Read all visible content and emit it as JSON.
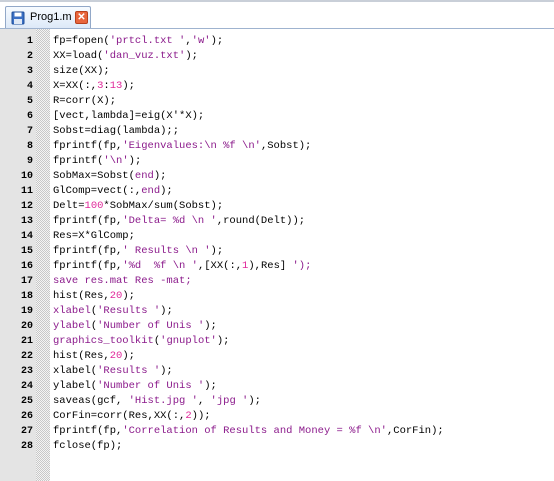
{
  "tab": {
    "label": "Prog1.m",
    "close_label": "✕",
    "icon": "floppy-disk-icon"
  },
  "colors": {
    "string": "#8b1a8b",
    "number": "#e0289a",
    "gutter": "#e4e4e4",
    "close": "#e8653c"
  },
  "editor": {
    "lines": [
      {
        "n": "1",
        "segs": [
          {
            "t": "fp=fopen("
          },
          {
            "t": "'prtcl.txt '",
            "c": "str"
          },
          {
            "t": ","
          },
          {
            "t": "'w'",
            "c": "str"
          },
          {
            "t": ");"
          }
        ]
      },
      {
        "n": "2",
        "segs": [
          {
            "t": "XX=load("
          },
          {
            "t": "'dan_vuz.txt'",
            "c": "str"
          },
          {
            "t": ");"
          }
        ]
      },
      {
        "n": "3",
        "segs": [
          {
            "t": "size(XX);"
          }
        ]
      },
      {
        "n": "4",
        "segs": [
          {
            "t": "X=XX(:,"
          },
          {
            "t": "3",
            "c": "num"
          },
          {
            "t": ":"
          },
          {
            "t": "13",
            "c": "num"
          },
          {
            "t": ");"
          }
        ]
      },
      {
        "n": "5",
        "segs": [
          {
            "t": "R=corr(X);"
          }
        ]
      },
      {
        "n": "6",
        "segs": [
          {
            "t": "[vect,lambda]=eig(X'*X);"
          }
        ]
      },
      {
        "n": "7",
        "segs": [
          {
            "t": "Sobst=diag(lambda);;"
          }
        ]
      },
      {
        "n": "8",
        "segs": [
          {
            "t": "fprintf(fp,"
          },
          {
            "t": "'Eigenvalues:\\n %f \\n'",
            "c": "str"
          },
          {
            "t": ",Sobst);"
          }
        ]
      },
      {
        "n": "9",
        "segs": [
          {
            "t": "fprintf("
          },
          {
            "t": "'\\n'",
            "c": "str"
          },
          {
            "t": ");"
          }
        ]
      },
      {
        "n": "10",
        "segs": [
          {
            "t": "SobMax=Sobst("
          },
          {
            "t": "end",
            "c": "str"
          },
          {
            "t": ");"
          }
        ]
      },
      {
        "n": "11",
        "segs": [
          {
            "t": "GlComp=vect(:,"
          },
          {
            "t": "end",
            "c": "str"
          },
          {
            "t": ");"
          }
        ]
      },
      {
        "n": "12",
        "segs": [
          {
            "t": "Delt="
          },
          {
            "t": "100",
            "c": "num"
          },
          {
            "t": "*SobMax/sum(Sobst);"
          }
        ]
      },
      {
        "n": "13",
        "segs": [
          {
            "t": "fprintf(fp,"
          },
          {
            "t": "'Delta= %d \\n '",
            "c": "str"
          },
          {
            "t": ",round(Delt));"
          }
        ]
      },
      {
        "n": "14",
        "segs": [
          {
            "t": "Res=X*GlComp;"
          }
        ]
      },
      {
        "n": "15",
        "segs": [
          {
            "t": "fprintf(fp,"
          },
          {
            "t": "' Results \\n '",
            "c": "str"
          },
          {
            "t": ");"
          }
        ]
      },
      {
        "n": "16",
        "segs": [
          {
            "t": "fprintf(fp,"
          },
          {
            "t": "'%d  %f \\n '",
            "c": "str"
          },
          {
            "t": ",[XX(:,"
          },
          {
            "t": "1",
            "c": "num"
          },
          {
            "t": "),Res] "
          },
          {
            "t": "');",
            "c": "str"
          }
        ]
      },
      {
        "n": "17",
        "segs": [
          {
            "t": "save res.mat Res -mat;",
            "c": "fn"
          }
        ]
      },
      {
        "n": "18",
        "segs": [
          {
            "t": "hist(Res,"
          },
          {
            "t": "20",
            "c": "num"
          },
          {
            "t": ");"
          }
        ]
      },
      {
        "n": "19",
        "segs": [
          {
            "t": "xlabel",
            "c": "fn"
          },
          {
            "t": "("
          },
          {
            "t": "'Results '",
            "c": "str"
          },
          {
            "t": ");"
          }
        ]
      },
      {
        "n": "20",
        "segs": [
          {
            "t": "ylabel",
            "c": "fn"
          },
          {
            "t": "("
          },
          {
            "t": "'Number of Unis '",
            "c": "str"
          },
          {
            "t": ");"
          }
        ]
      },
      {
        "n": "21",
        "segs": [
          {
            "t": "graphics_toolkit",
            "c": "fn"
          },
          {
            "t": "("
          },
          {
            "t": "'gnuplot'",
            "c": "str"
          },
          {
            "t": ");"
          }
        ]
      },
      {
        "n": "22",
        "segs": [
          {
            "t": "hist(Res,"
          },
          {
            "t": "20",
            "c": "num"
          },
          {
            "t": ");"
          }
        ]
      },
      {
        "n": "23",
        "segs": [
          {
            "t": "xlabel("
          },
          {
            "t": "'Results '",
            "c": "str"
          },
          {
            "t": ");"
          }
        ]
      },
      {
        "n": "24",
        "segs": [
          {
            "t": "ylabel("
          },
          {
            "t": "'Number of Unis '",
            "c": "str"
          },
          {
            "t": ");"
          }
        ]
      },
      {
        "n": "25",
        "segs": [
          {
            "t": "saveas(gcf, "
          },
          {
            "t": "'Hist.jpg '",
            "c": "str"
          },
          {
            "t": ", "
          },
          {
            "t": "'jpg '",
            "c": "str"
          },
          {
            "t": ");"
          }
        ]
      },
      {
        "n": "26",
        "segs": [
          {
            "t": "CorFin=corr(Res,XX(:,"
          },
          {
            "t": "2",
            "c": "num"
          },
          {
            "t": "));"
          }
        ]
      },
      {
        "n": "27",
        "segs": [
          {
            "t": "fprintf(fp,"
          },
          {
            "t": "'Correlation of Results and Money = %f \\n'",
            "c": "str"
          },
          {
            "t": ",CorFin);"
          }
        ]
      },
      {
        "n": "28",
        "segs": [
          {
            "t": "fclose(fp);"
          }
        ]
      }
    ]
  }
}
